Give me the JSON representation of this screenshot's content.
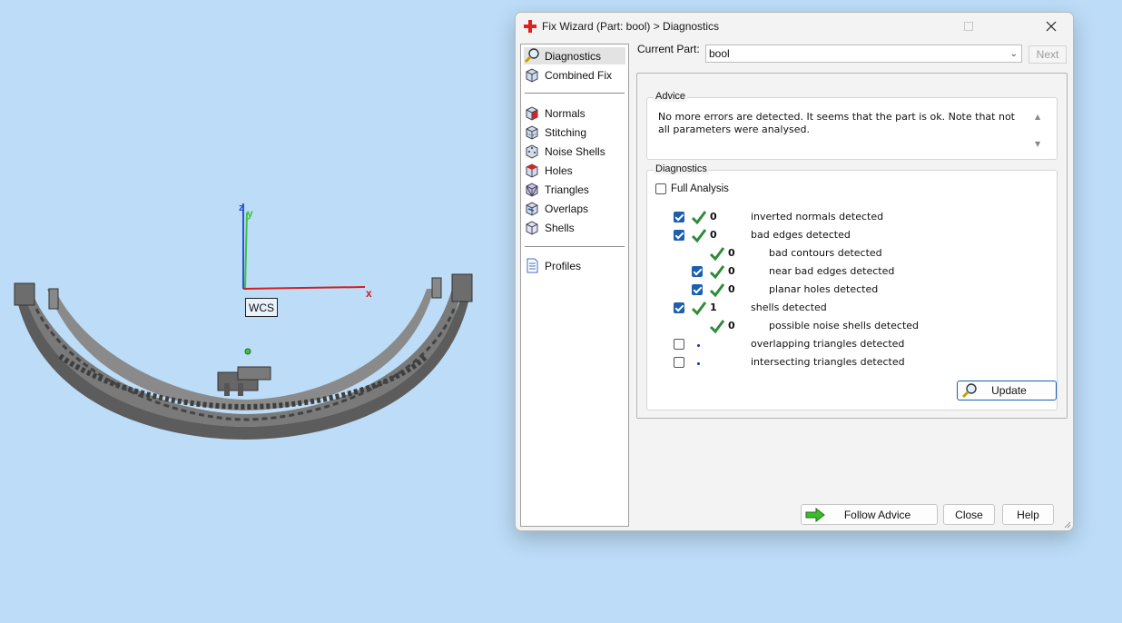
{
  "viewport": {
    "axis_x_label": "x",
    "axis_y_label": "y",
    "axis_z_label": "z",
    "wcs_label": "WCS"
  },
  "dialog": {
    "title": "Fix Wizard (Part: bool) > Diagnostics",
    "nav": {
      "items": [
        {
          "label": "Diagnostics",
          "icon": "magnifier-icon",
          "selected": true
        },
        {
          "label": "Combined Fix",
          "icon": "cube-icon"
        },
        {
          "label": "Normals",
          "icon": "normals-cube-icon"
        },
        {
          "label": "Stitching",
          "icon": "stitching-cube-icon"
        },
        {
          "label": "Noise Shells",
          "icon": "noise-shells-icon"
        },
        {
          "label": "Holes",
          "icon": "holes-cube-icon"
        },
        {
          "label": "Triangles",
          "icon": "triangles-cube-icon"
        },
        {
          "label": "Overlaps",
          "icon": "overlaps-cube-icon"
        },
        {
          "label": "Shells",
          "icon": "shells-cube-icon"
        },
        {
          "label": "Profiles",
          "icon": "document-icon"
        }
      ]
    },
    "current_part_label": "Current Part:",
    "current_part_value": "bool",
    "next_label": "Next",
    "advice": {
      "title": "Advice",
      "text": "No more errors are detected. It seems that the part is ok. Note that not all parameters were analysed."
    },
    "diagnostics": {
      "title": "Diagnostics",
      "full_analysis_label": "Full Analysis",
      "full_analysis_checked": false,
      "rows": [
        {
          "checked": true,
          "status": "ok",
          "count": "0",
          "label": "inverted normals detected"
        },
        {
          "checked": true,
          "status": "ok",
          "count": "0",
          "label": "bad edges detected"
        },
        {
          "checkbox": false,
          "status": "ok",
          "count": "0",
          "label": "bad contours detected"
        },
        {
          "checked": true,
          "status": "ok",
          "count": "0",
          "label": "near bad edges detected"
        },
        {
          "checked": true,
          "status": "ok",
          "count": "0",
          "label": "planar holes detected"
        },
        {
          "checked": true,
          "status": "ok",
          "count": "1",
          "label": "shells detected"
        },
        {
          "checkbox": false,
          "status": "ok",
          "count": "0",
          "label": "possible noise shells detected"
        },
        {
          "checked": false,
          "status": "none",
          "count": "",
          "label": "overlapping triangles detected"
        },
        {
          "checked": false,
          "status": "none",
          "count": "",
          "label": "intersecting triangles detected"
        }
      ],
      "update_label": "Update"
    },
    "follow_advice_label": "Follow Advice",
    "close_label": "Close",
    "help_label": "Help"
  }
}
